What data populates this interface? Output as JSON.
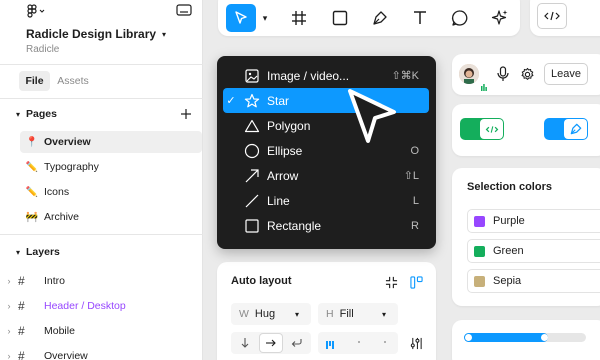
{
  "sidebar": {
    "file_name": "Radicle Design Library",
    "team": "Radicle",
    "tabs": [
      {
        "label": "File"
      },
      {
        "label": "Assets"
      }
    ],
    "pages_title": "Pages",
    "pages": [
      {
        "emoji": "📍",
        "label": "Overview"
      },
      {
        "emoji": "✏️",
        "label": "Typography"
      },
      {
        "emoji": "✏️",
        "label": "Icons"
      },
      {
        "emoji": "🚧",
        "label": "Archive"
      }
    ],
    "layers_title": "Layers",
    "layers": [
      {
        "label": "Intro"
      },
      {
        "label": "Header / Desktop"
      },
      {
        "label": "Mobile"
      },
      {
        "label": "Overview"
      }
    ],
    "highlight_color": "#9747ff"
  },
  "menu": {
    "items": [
      {
        "label": "Image / video...",
        "shortcut": "⇧⌘K",
        "icon": "image-icon",
        "checked": false
      },
      {
        "label": "Star",
        "shortcut": "",
        "icon": "star-icon",
        "checked": true
      },
      {
        "label": "Polygon",
        "shortcut": "",
        "icon": "triangle-icon",
        "checked": false
      },
      {
        "label": "Ellipse",
        "shortcut": "O",
        "icon": "circle-icon",
        "checked": false
      },
      {
        "label": "Arrow",
        "shortcut": "⇧L",
        "icon": "arrow-icon",
        "checked": false
      },
      {
        "label": "Line",
        "shortcut": "L",
        "icon": "line-icon",
        "checked": false
      },
      {
        "label": "Rectangle",
        "shortcut": "R",
        "icon": "rectangle-icon",
        "checked": false
      }
    ],
    "check": "✓"
  },
  "collab": {
    "leave_label": "Leave"
  },
  "selection_colors": {
    "title": "Selection colors",
    "items": [
      {
        "name": "Purple",
        "color": "#9747ff"
      },
      {
        "name": "Green",
        "color": "#14ae5c"
      },
      {
        "name": "Sepia",
        "color": "#c7b07a"
      }
    ]
  },
  "auto_layout": {
    "title": "Auto layout",
    "width_key": "W",
    "width_value": "Hug",
    "height_key": "H",
    "height_value": "Fill"
  },
  "colors": {
    "accent": "#0d99ff",
    "toggle_green": "#14ae5c"
  }
}
